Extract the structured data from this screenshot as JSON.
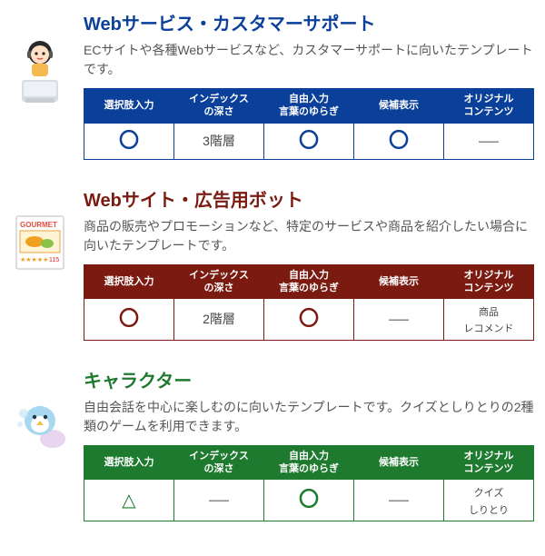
{
  "headers": [
    "選択肢入力",
    "インデックス\nの深さ",
    "自由入力\n言葉のゆらぎ",
    "候補表示",
    "オリジナル\nコンテンツ"
  ],
  "sections": [
    {
      "id": "customer-support",
      "theme": "s-blue",
      "title": "Webサービス・カスタマーサポート",
      "desc": "ECサイトや各種Webサービスなど、カスタマーサポートに向いたテンプレートです。",
      "cells": [
        {
          "type": "circle"
        },
        {
          "type": "text",
          "value": "3階層"
        },
        {
          "type": "circle"
        },
        {
          "type": "circle"
        },
        {
          "type": "dash"
        }
      ]
    },
    {
      "id": "ad-bot",
      "theme": "s-red",
      "title": "Webサイト・広告用ボット",
      "desc": "商品の販売やプロモーションなど、特定のサービスや商品を紹介したい場合に向いたテンプレートです。",
      "cells": [
        {
          "type": "circle"
        },
        {
          "type": "text",
          "value": "2階層"
        },
        {
          "type": "circle"
        },
        {
          "type": "dash"
        },
        {
          "type": "small",
          "value": "商品\nレコメンド"
        }
      ]
    },
    {
      "id": "character",
      "theme": "s-green",
      "title": "キャラクター",
      "desc": "自由会話を中心に楽しむのに向いたテンプレートです。クイズとしりとりの2種類のゲームを利用できます。",
      "cells": [
        {
          "type": "triangle"
        },
        {
          "type": "dash"
        },
        {
          "type": "circle"
        },
        {
          "type": "dash"
        },
        {
          "type": "small",
          "value": "クイズ\nしりとり"
        }
      ]
    }
  ]
}
